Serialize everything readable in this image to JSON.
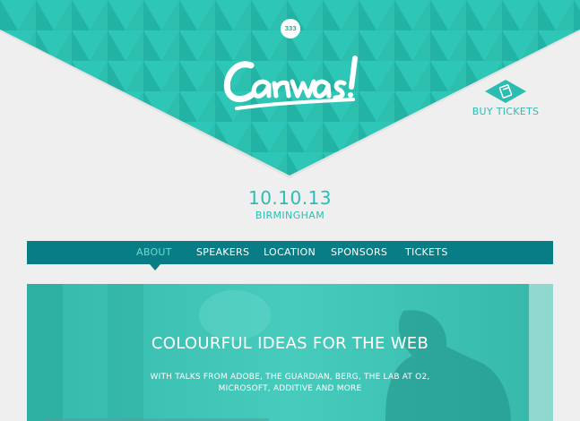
{
  "header": {
    "badge": "333",
    "logo_text": "Canvas!",
    "buy_tickets_label": "BUY TICKETS"
  },
  "event": {
    "date": "10.10.13",
    "city": "BIRMINGHAM"
  },
  "nav": {
    "active": "ABOUT",
    "items": [
      {
        "label": "ABOUT"
      },
      {
        "label": "SPEAKERS"
      },
      {
        "label": "LOCATION"
      },
      {
        "label": "SPONSORS"
      },
      {
        "label": "TICKETS"
      }
    ]
  },
  "banner": {
    "title": "COLOURFUL IDEAS FOR THE WEB",
    "subtitle": "WITH TALKS FROM ADOBE, THE GUARDIAN, BERG, THE LAB AT O2, MICROSOFT, ADDITIVE AND MORE"
  },
  "colors": {
    "teal": "#2cbdb2",
    "hero": "#27bfb0",
    "nav": "#097d85",
    "background": "#efefef"
  },
  "icons": {
    "buy_tickets": "ticket-icon"
  }
}
